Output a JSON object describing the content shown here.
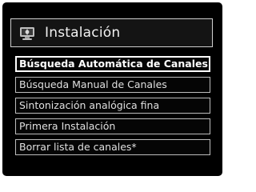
{
  "header": {
    "title": "Instalación",
    "icon": "installation-icon"
  },
  "menu": {
    "items": [
      {
        "label": "Búsqueda Automática de Canales",
        "selected": true
      },
      {
        "label": "Búsqueda Manual de Canales",
        "selected": false
      },
      {
        "label": "Sintonización analógica fina",
        "selected": false
      },
      {
        "label": "Primera Instalación",
        "selected": false
      },
      {
        "label": "Borrar lista de canales*",
        "selected": false
      }
    ]
  },
  "colors": {
    "background": "#000000",
    "text": "#e0e0e0",
    "border": "#bdbdbd",
    "selected_border": "#ffffff"
  }
}
